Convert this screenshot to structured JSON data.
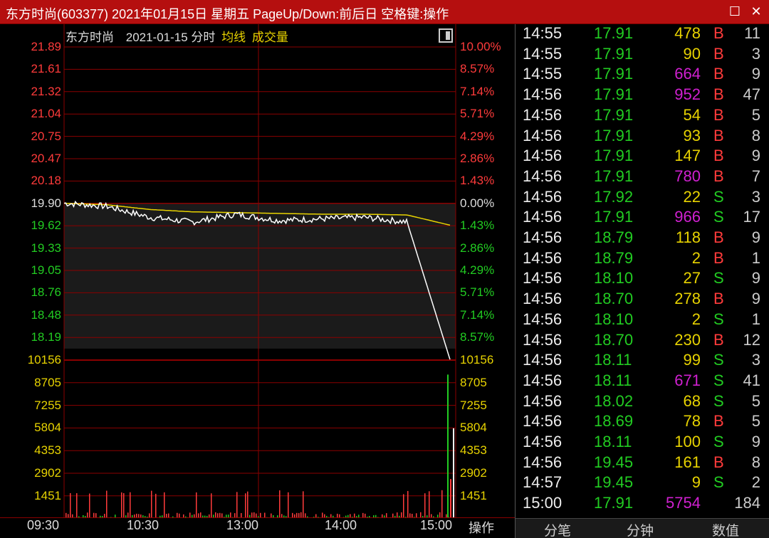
{
  "window": {
    "title": "东方时尚(603377) 2021年01月15日 星期五 PageUp/Down:前后日 空格键:操作",
    "max_icon": "maximize-icon",
    "close_icon": "close-icon"
  },
  "chart_header": {
    "name": "东方时尚",
    "date": "2021-01-15 分时",
    "avg_label": "均线",
    "vol_label": "成交量"
  },
  "colors": {
    "up": "#ff3b3b",
    "down": "#22cc22",
    "avg_line": "#e8d300",
    "price_line": "#ffffff",
    "grid": "#8b0000",
    "magenta": "#d020d0",
    "yellow": "#e8d300"
  },
  "price_axis": {
    "left": [
      "21.89",
      "21.61",
      "21.32",
      "21.04",
      "20.75",
      "20.47",
      "20.18",
      "19.90",
      "19.62",
      "19.33",
      "19.05",
      "18.76",
      "18.48",
      "18.19"
    ],
    "right": [
      "10.00%",
      "8.57%",
      "7.14%",
      "5.71%",
      "4.29%",
      "2.86%",
      "1.43%",
      "0.00%",
      "1.43%",
      "2.86%",
      "4.29%",
      "5.71%",
      "7.14%",
      "8.57%"
    ]
  },
  "volume_axis": {
    "left": [
      "10156",
      "8705",
      "7255",
      "5804",
      "4353",
      "2902",
      "1451"
    ],
    "right": [
      "10156",
      "8705",
      "7255",
      "5804",
      "4353",
      "2902",
      "1451"
    ]
  },
  "time_axis": [
    "09:30",
    "10:30",
    "13:00",
    "14:00",
    "15:00"
  ],
  "op_label": "操作",
  "chart_data": {
    "type": "line",
    "title": "东方时尚 2021-01-15 分时",
    "prev_close": 19.9,
    "ylim": [
      18.19,
      21.89
    ],
    "x": [
      "09:30",
      "10:00",
      "10:30",
      "11:00",
      "11:30/13:00",
      "13:30",
      "14:00",
      "14:30",
      "14:50",
      "15:00"
    ],
    "series": [
      {
        "name": "price",
        "values": [
          19.9,
          19.86,
          19.72,
          19.66,
          19.76,
          19.68,
          19.7,
          19.72,
          19.66,
          17.91
        ]
      },
      {
        "name": "均线",
        "values": [
          19.9,
          19.88,
          19.82,
          19.79,
          19.78,
          19.77,
          19.76,
          19.76,
          19.75,
          19.62
        ]
      }
    ],
    "volume": {
      "ylim": [
        0,
        10156
      ],
      "late_spike": 9200,
      "close_bar": 5754
    }
  },
  "trades": [
    {
      "time": "14:55",
      "price": "17.91",
      "vol": "478",
      "vc": "yellow",
      "side": "B",
      "cnt": "11"
    },
    {
      "time": "14:55",
      "price": "17.91",
      "vol": "90",
      "vc": "yellow",
      "side": "B",
      "cnt": "3"
    },
    {
      "time": "14:55",
      "price": "17.91",
      "vol": "664",
      "vc": "magenta",
      "side": "B",
      "cnt": "9"
    },
    {
      "time": "14:56",
      "price": "17.91",
      "vol": "952",
      "vc": "magenta",
      "side": "B",
      "cnt": "47"
    },
    {
      "time": "14:56",
      "price": "17.91",
      "vol": "54",
      "vc": "yellow",
      "side": "B",
      "cnt": "5"
    },
    {
      "time": "14:56",
      "price": "17.91",
      "vol": "93",
      "vc": "yellow",
      "side": "B",
      "cnt": "8"
    },
    {
      "time": "14:56",
      "price": "17.91",
      "vol": "147",
      "vc": "yellow",
      "side": "B",
      "cnt": "9"
    },
    {
      "time": "14:56",
      "price": "17.91",
      "vol": "780",
      "vc": "magenta",
      "side": "B",
      "cnt": "7"
    },
    {
      "time": "14:56",
      "price": "17.92",
      "vol": "22",
      "vc": "yellow",
      "side": "S",
      "cnt": "3"
    },
    {
      "time": "14:56",
      "price": "17.91",
      "vol": "966",
      "vc": "magenta",
      "side": "S",
      "cnt": "17"
    },
    {
      "time": "14:56",
      "price": "18.79",
      "vol": "118",
      "vc": "yellow",
      "side": "B",
      "cnt": "9"
    },
    {
      "time": "14:56",
      "price": "18.79",
      "vol": "2",
      "vc": "yellow",
      "side": "B",
      "cnt": "1"
    },
    {
      "time": "14:56",
      "price": "18.10",
      "vol": "27",
      "vc": "yellow",
      "side": "S",
      "cnt": "9"
    },
    {
      "time": "14:56",
      "price": "18.70",
      "vol": "278",
      "vc": "yellow",
      "side": "B",
      "cnt": "9"
    },
    {
      "time": "14:56",
      "price": "18.10",
      "vol": "2",
      "vc": "yellow",
      "side": "S",
      "cnt": "1"
    },
    {
      "time": "14:56",
      "price": "18.70",
      "vol": "230",
      "vc": "yellow",
      "side": "B",
      "cnt": "12"
    },
    {
      "time": "14:56",
      "price": "18.11",
      "vol": "99",
      "vc": "yellow",
      "side": "S",
      "cnt": "3"
    },
    {
      "time": "14:56",
      "price": "18.11",
      "vol": "671",
      "vc": "magenta",
      "side": "S",
      "cnt": "41"
    },
    {
      "time": "14:56",
      "price": "18.02",
      "vol": "68",
      "vc": "yellow",
      "side": "S",
      "cnt": "5"
    },
    {
      "time": "14:56",
      "price": "18.69",
      "vol": "78",
      "vc": "yellow",
      "side": "B",
      "cnt": "5"
    },
    {
      "time": "14:56",
      "price": "18.11",
      "vol": "100",
      "vc": "yellow",
      "side": "S",
      "cnt": "9"
    },
    {
      "time": "14:56",
      "price": "19.45",
      "vol": "161",
      "vc": "yellow",
      "side": "B",
      "cnt": "8"
    },
    {
      "time": "14:57",
      "price": "19.45",
      "vol": "9",
      "vc": "yellow",
      "side": "S",
      "cnt": "2"
    },
    {
      "time": "15:00",
      "price": "17.91",
      "vol": "5754",
      "vc": "magenta",
      "side": "",
      "cnt": "184"
    }
  ],
  "tabs": [
    {
      "label": "分笔",
      "active": true
    },
    {
      "label": "分钟",
      "active": false
    },
    {
      "label": "数值",
      "active": false
    }
  ]
}
